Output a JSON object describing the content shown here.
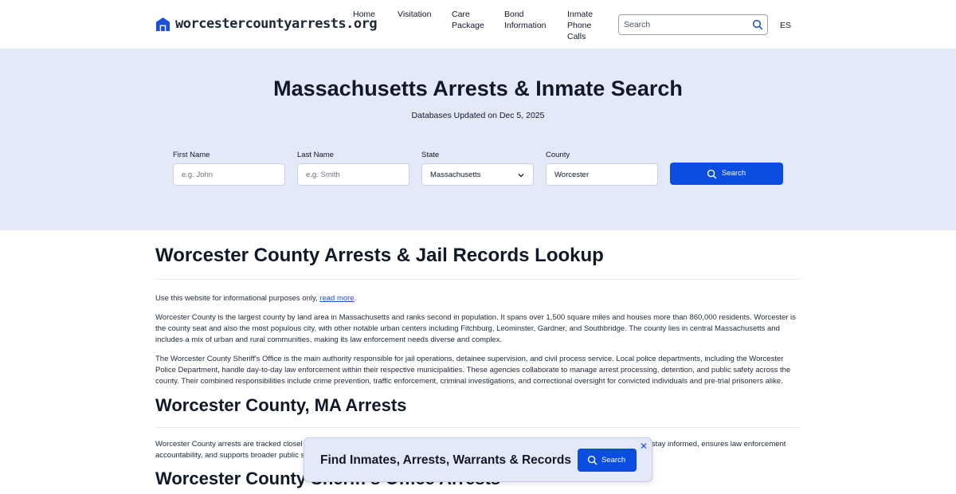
{
  "header": {
    "logo_text": "worcestercountyarrests.org",
    "nav": [
      {
        "label": "Home"
      },
      {
        "label": "Visitation"
      },
      {
        "label": "Care\nPackage"
      },
      {
        "label": "Bond\nInformation"
      },
      {
        "label": "Inmate\nPhone\nCalls"
      }
    ],
    "search_placeholder": "Search",
    "lang": "ES"
  },
  "hero": {
    "title": "Massachusetts Arrests & Inmate Search",
    "subtitle": "Databases Updated on Dec 5, 2025",
    "fields": {
      "first_name_label": "First Name",
      "first_name_placeholder": "e.g. John",
      "last_name_label": "Last Name",
      "last_name_placeholder": "e.g. Smith",
      "state_label": "State",
      "state_value": "Massachusetts",
      "county_label": "County",
      "county_value": "Worcester"
    },
    "search_button": "Search"
  },
  "content": {
    "h1": "Worcester County Arrests & Jail Records Lookup",
    "disclaimer_prefix": "Use this website for informational purposes only, ",
    "disclaimer_link": "read more",
    "disclaimer_suffix": ".",
    "para1": "Worcester County is the largest county by land area in Massachusetts and ranks second in population. It spans over 1,500 square miles and houses more than 860,000 residents. Worcester is the county seat and also the most populous city, with other notable urban centers including Fitchburg, Leominster, Gardner, and Southbridge. The county lies in central Massachusetts and includes a mix of urban and rural communities, making its law enforcement needs diverse and complex.",
    "para2": "The Worcester County Sheriff's Office is the main authority responsible for jail operations, detainee supervision, and civil process service. Local police departments, including the Worcester Police Department, handle day-to-day law enforcement within their respective municipalities. These agencies collaborate to manage arrest processing, detention, and public safety across the county. Their combined responsibilities include crime prevention, traffic enforcement, criminal investigations, and correctional oversight for convicted individuals and pre-trial prisoners alike.",
    "h2": "Worcester County, MA Arrests",
    "para3_start": "Worcester County arrests are tracked closel",
    "para3_end": "stay informed, ensures law enforcement",
    "para3_line2": "accountability, and supports broader public s",
    "h3": "Worcester County Sheriff's Office Arrests"
  },
  "popup": {
    "text": "Find Inmates, Arrests, Warrants & Records",
    "button": "Search",
    "close": "✕"
  },
  "colors": {
    "accent": "#0b4de0",
    "hero_bg": "#e4e9f8"
  }
}
